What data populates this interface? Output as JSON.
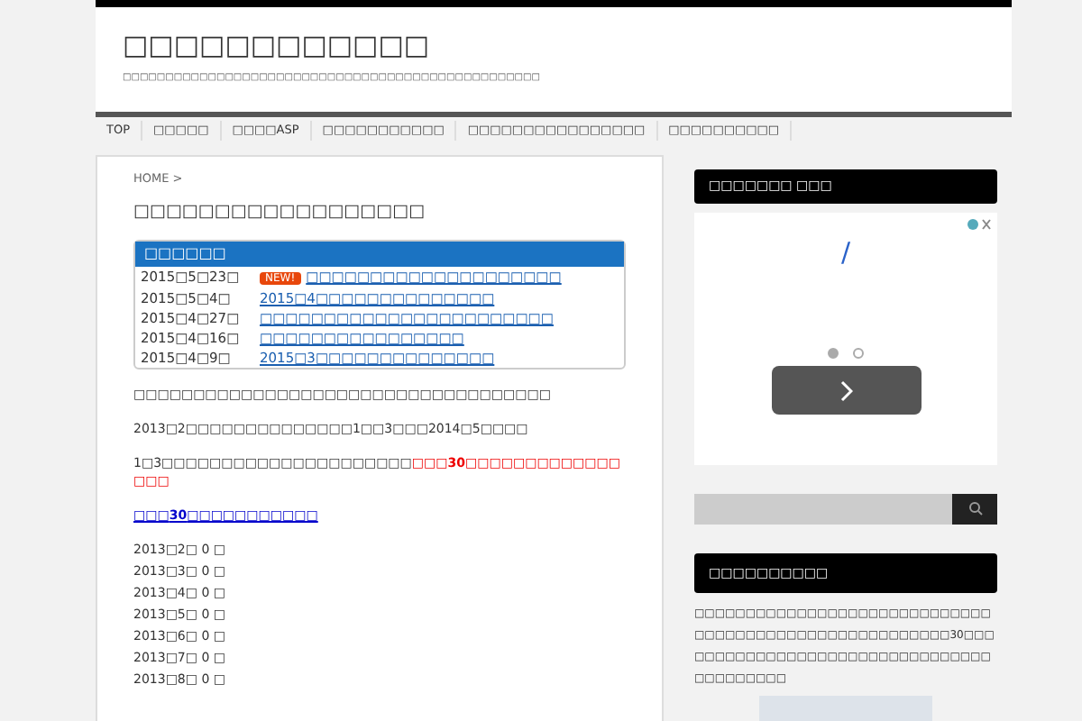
{
  "site": {
    "title": "□□□□□□□□□□□□",
    "tagline": "□□□□□□□□□□□□□□□□□□□□□□□□□□□□□□□□□□□□□□□□□□□□□□□□□"
  },
  "nav": [
    "TOP",
    "□□□□□",
    "□□□□ASP",
    "□□□□□□□□□□□",
    "□□□□□□□□□□□□□□□□",
    "□□□□□□□□□□"
  ],
  "breadcrumb": "HOME >",
  "post_title": "□□□□□□□□□□□□□□□□□□",
  "news": {
    "title": "□□□□□□",
    "items": [
      {
        "date": "2015□5□23□",
        "badge": "NEW!",
        "link": "□□□□□□□□□□□□□□□□□□□□"
      },
      {
        "date": "2015□5□4□",
        "link": "2015□4□□□□□□□□□□□□□□"
      },
      {
        "date": "2015□4□27□",
        "link": "□□□□□□□□□□□□□□□□□□□□□□□"
      },
      {
        "date": "2015□4□16□",
        "link": "□□□□□□□□□□□□□□□□"
      },
      {
        "date": "2015□4□9□",
        "link": "2015□3□□□□□□□□□□□□□□"
      }
    ]
  },
  "body": [
    {
      "kind": "text",
      "text": "□□□□□□□□□□□□□□□□□□□□□□□□□□□□□□□□□□□"
    },
    {
      "kind": "text",
      "text": "2013□2□□□□□□□□□□□□□□1□□3□□□2014□5□□□□"
    },
    {
      "kind": "mixed",
      "text": "1□3□□□□□□□□□□□□□□□□□□□□□",
      "highlight": "□□□**30**□□□□□□□□□□□□□□□□"
    },
    {
      "kind": "link",
      "text": "□□□**30**□□□□□□□□□□□"
    }
  ],
  "months": [
    "2013□2□ 0 □",
    "2013□3□ 0 □",
    "2013□4□ 0 □",
    "2013□5□ 0 □",
    "2013□6□ 0 □",
    "2013□7□ 0 □",
    "2013□8□ 0 □"
  ],
  "sidebar": {
    "ad_title": "□□□□□□□ □□□",
    "ad_char": "/",
    "ad_dots": [
      {
        "selected": true
      },
      {
        "selected": false
      }
    ],
    "widget_title": "□□□□□□□□□□",
    "widget_text": "□□□□□□□□□□□□□□□□□□□□□□□□□□□□□□□□□□□□□□□□□□□□□□□□□□□□□□30□□□□□□□□□□□□□□□□□□□□□□□□□□□□□□□□□□□□□□□□□"
  }
}
